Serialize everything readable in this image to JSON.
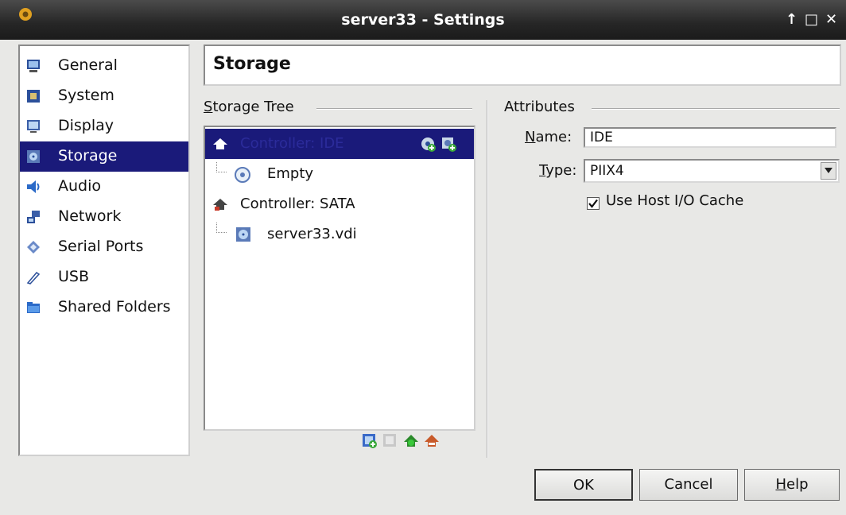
{
  "window": {
    "title": "server33 - Settings",
    "controls": [
      "↑",
      "□",
      "✕"
    ]
  },
  "sidebar": {
    "items": [
      {
        "label": "General",
        "icon": "monitor-icon"
      },
      {
        "label": "System",
        "icon": "chip-icon"
      },
      {
        "label": "Display",
        "icon": "display-icon"
      },
      {
        "label": "Storage",
        "icon": "disk-icon",
        "selected": true
      },
      {
        "label": "Audio",
        "icon": "speaker-icon"
      },
      {
        "label": "Network",
        "icon": "network-icon"
      },
      {
        "label": "Serial Ports",
        "icon": "serial-port-icon"
      },
      {
        "label": "USB",
        "icon": "usb-icon"
      },
      {
        "label": "Shared Folders",
        "icon": "folder-icon"
      }
    ]
  },
  "page": {
    "title": "Storage"
  },
  "storage_tree": {
    "heading_first": "S",
    "heading_rest": "torage Tree",
    "items": [
      {
        "label": "Controller: IDE",
        "type": "controller",
        "selected": true
      },
      {
        "label": "Empty",
        "type": "optical-disc"
      },
      {
        "label": "Controller: SATA",
        "type": "controller"
      },
      {
        "label": "server33.vdi",
        "type": "hard-disk"
      }
    ]
  },
  "attributes": {
    "heading": "Attributes",
    "name_label_first": "N",
    "name_label_rest": "ame:",
    "name_value": "IDE",
    "type_label_first": "T",
    "type_label_rest": "ype:",
    "type_value": "PIIX4",
    "host_cache_label": "Use Host I/O Cache",
    "host_cache_checked": true
  },
  "buttons": {
    "ok": "OK",
    "cancel": "Cancel",
    "help_first": "H",
    "help_rest": "elp"
  },
  "colors": {
    "selection": "#1a1a7a",
    "titlebar": "#262626"
  }
}
